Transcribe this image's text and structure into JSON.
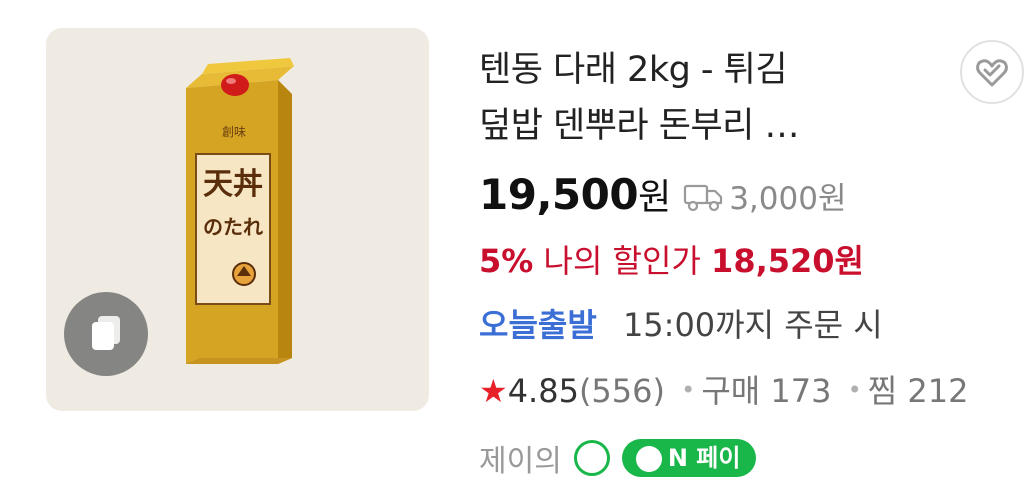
{
  "product": {
    "title_line1": "텐동 다래 2kg - 튀김",
    "title_line2": "덮밥 덴뿌라 돈부리 …",
    "price": "19,500",
    "price_unit": "원",
    "shipping_fee": "3,000원",
    "discount_pct": "5%",
    "discount_label": "나의 할인가",
    "discount_price": "18,520원",
    "today_ship": "오늘출발",
    "today_ship_desc": "15:00까지 주문 시",
    "rating_star": "★",
    "rating": "4.85",
    "review_count": "(556)",
    "purchase": "구매 173",
    "wish": "찜 212",
    "seller": "제이의",
    "badge_text": "N 페이"
  },
  "package": {
    "top_label": "創味",
    "name_large": "天丼",
    "name_small": "のたれ"
  },
  "colors": {
    "discount": "#c8102e",
    "today_ship": "#3b6fd6",
    "star": "#e8202a",
    "badge": "#19b64a"
  },
  "icons": {
    "copy": "copy-icon",
    "wish": "heart-icon",
    "shipping": "truck-icon"
  }
}
